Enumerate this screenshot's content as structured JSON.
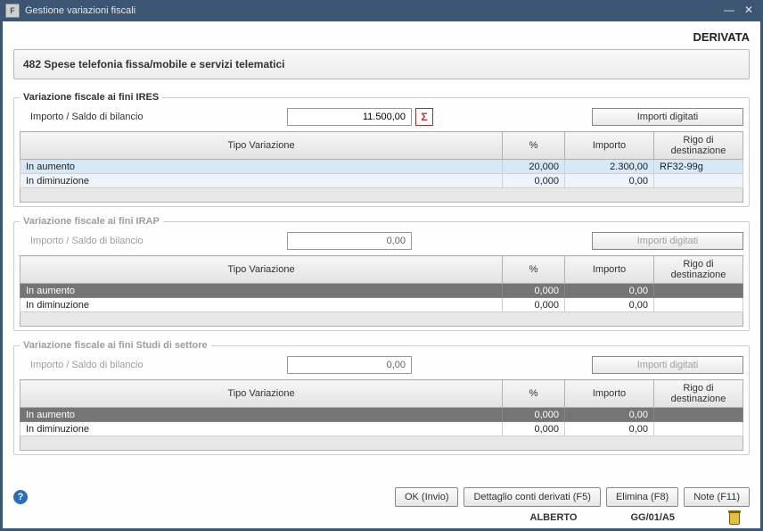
{
  "window": {
    "title": "Gestione variazioni fiscali",
    "app_icon_glyph": "F"
  },
  "derivata_label": "DERIVATA",
  "header_text": "482 Spese telefonia fissa/mobile e servizi telematici",
  "labels": {
    "importo_saldo": "Importo / Saldo di bilancio",
    "tipo_variazione": "Tipo Variazione",
    "pct": "%",
    "importo": "Importo",
    "rigo": "Rigo di destinazione",
    "importi_digitati": "Importi digitati",
    "sigma": "Σ"
  },
  "sections": {
    "ires": {
      "legend": "Variazione fiscale ai fini IRES",
      "saldo": "11.500,00",
      "rows": [
        {
          "tipo": "In aumento",
          "pct": "20,000",
          "importo": "2.300,00",
          "rigo": "RF32-99g"
        },
        {
          "tipo": "In diminuzione",
          "pct": "0,000",
          "importo": "0,00",
          "rigo": ""
        }
      ]
    },
    "irap": {
      "legend": "Variazione fiscale ai fini IRAP",
      "saldo": "0,00",
      "rows": [
        {
          "tipo": "In aumento",
          "pct": "0,000",
          "importo": "0,00",
          "rigo": ""
        },
        {
          "tipo": "In diminuzione",
          "pct": "0,000",
          "importo": "0,00",
          "rigo": ""
        }
      ]
    },
    "studi": {
      "legend": "Variazione fiscale ai fini Studi di settore",
      "saldo": "0,00",
      "rows": [
        {
          "tipo": "In aumento",
          "pct": "0,000",
          "importo": "0,00",
          "rigo": ""
        },
        {
          "tipo": "In diminuzione",
          "pct": "0,000",
          "importo": "0,00",
          "rigo": ""
        }
      ]
    }
  },
  "buttons": {
    "ok": "OK (Invio)",
    "dettaglio": "Dettaglio conti derivati (F5)",
    "elimina": "Elimina (F8)",
    "note": "Note (F11)"
  },
  "status": {
    "user": "ALBERTO",
    "code": "GG/01/A5"
  },
  "help_glyph": "?"
}
